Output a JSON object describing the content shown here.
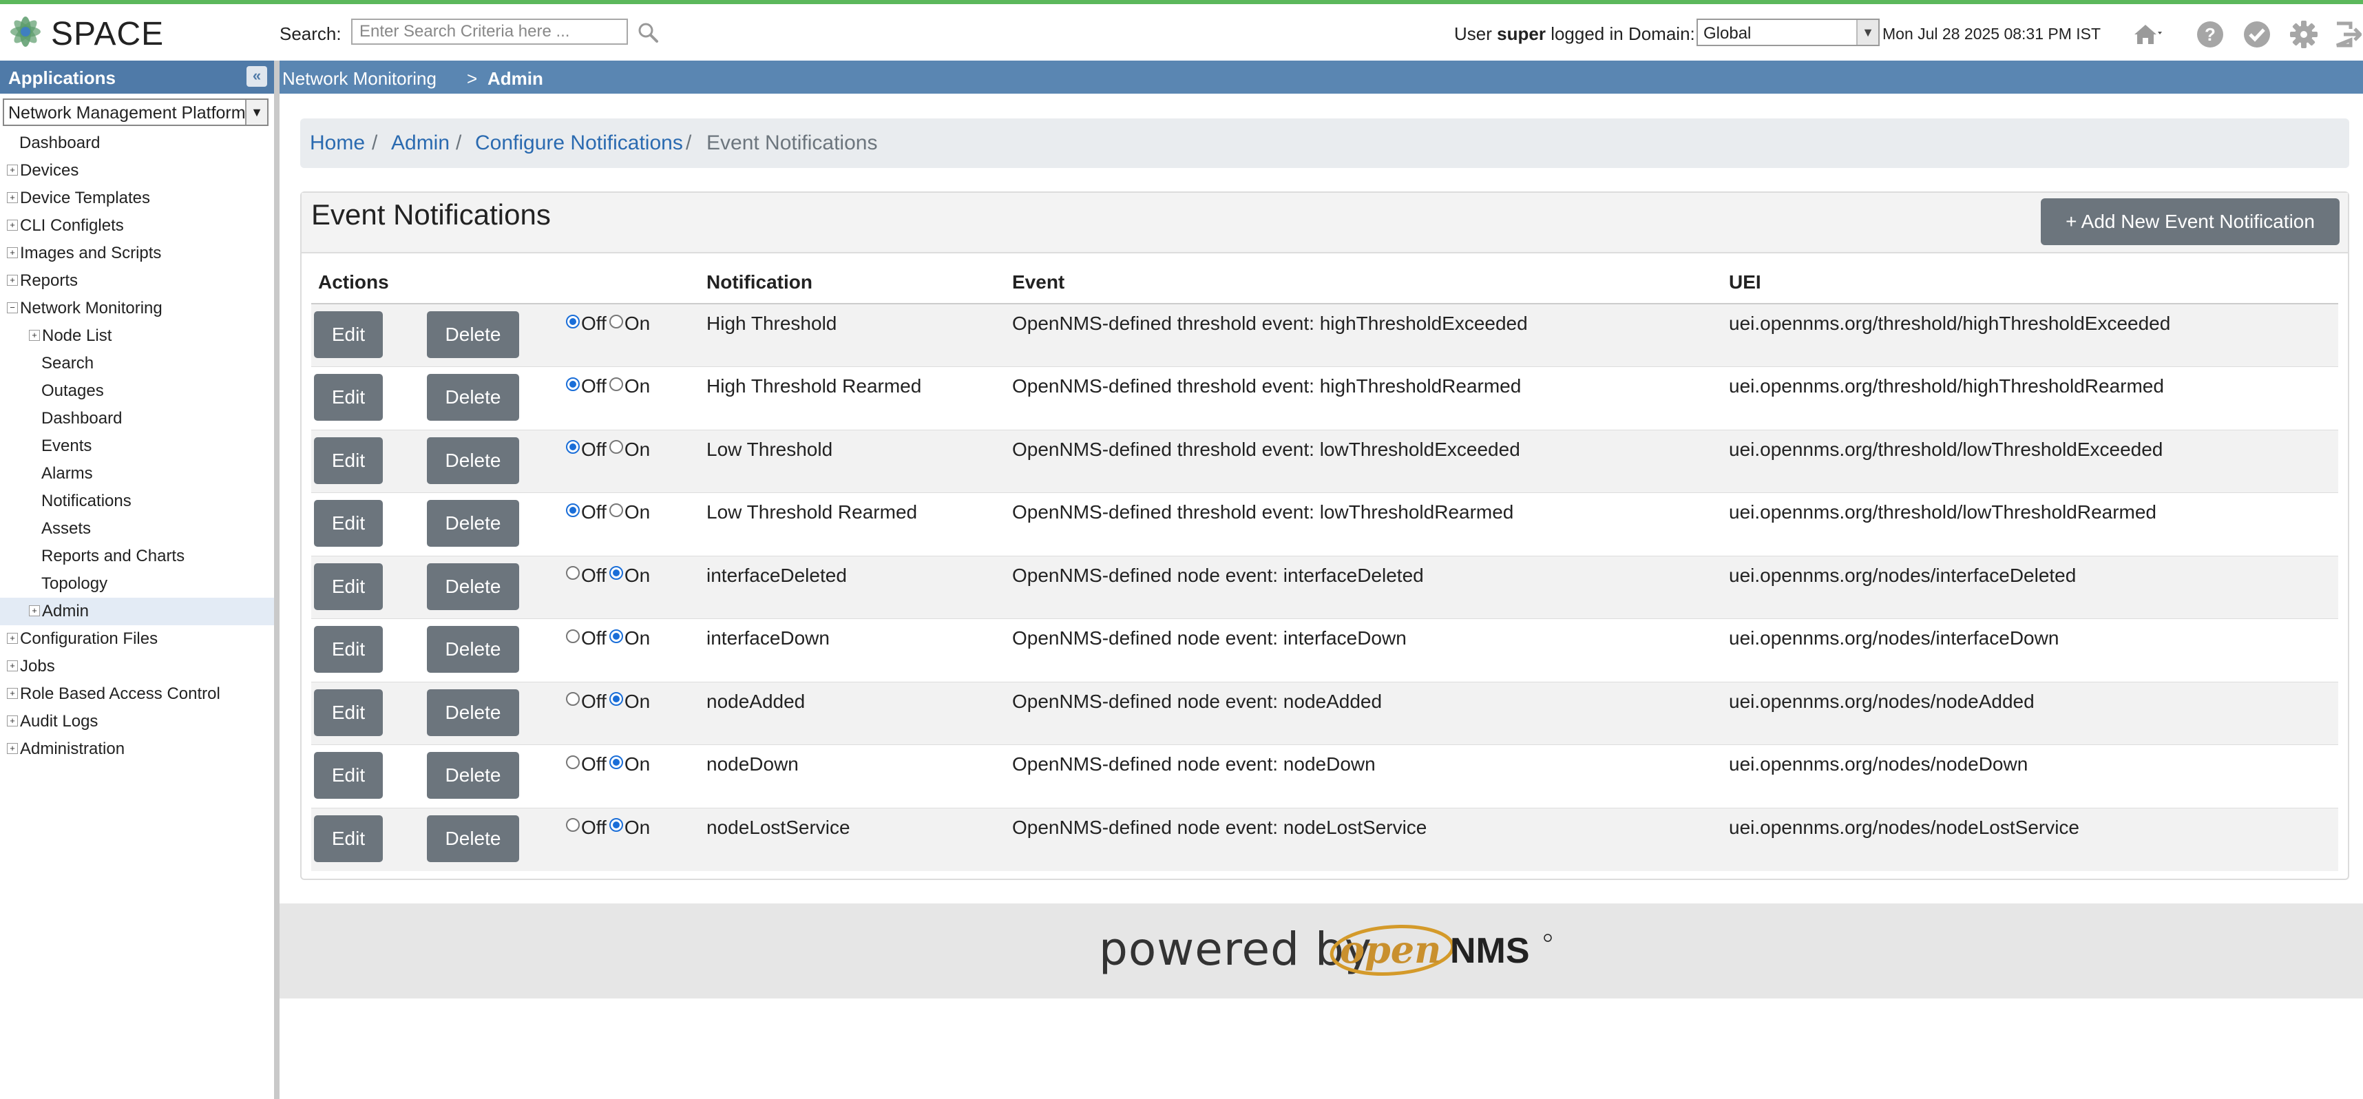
{
  "app": {
    "logo_text": "SPACE"
  },
  "search": {
    "label": "Search:",
    "placeholder": "Enter Search Criteria here ..."
  },
  "user": {
    "prefix": "User",
    "name": "super",
    "suffix": "logged in Domain:"
  },
  "domain": {
    "selected": "Global"
  },
  "datetime": "Mon Jul 28 2025 08:31 PM IST",
  "left_panel": {
    "header": "Applications",
    "platform_selected": "Network Management Platform",
    "tree": [
      {
        "label": "Dashboard",
        "level": 0,
        "expander": "none"
      },
      {
        "label": "Devices",
        "level": 0,
        "expander": "plus"
      },
      {
        "label": "Device Templates",
        "level": 0,
        "expander": "plus"
      },
      {
        "label": "CLI Configlets",
        "level": 0,
        "expander": "plus"
      },
      {
        "label": "Images and Scripts",
        "level": 0,
        "expander": "plus"
      },
      {
        "label": "Reports",
        "level": 0,
        "expander": "plus"
      },
      {
        "label": "Network Monitoring",
        "level": 0,
        "expander": "minus"
      },
      {
        "label": "Node List",
        "level": 1,
        "expander": "plus"
      },
      {
        "label": "Search",
        "level": 1,
        "expander": "none"
      },
      {
        "label": "Outages",
        "level": 1,
        "expander": "none"
      },
      {
        "label": "Dashboard",
        "level": 1,
        "expander": "none"
      },
      {
        "label": "Events",
        "level": 1,
        "expander": "none"
      },
      {
        "label": "Alarms",
        "level": 1,
        "expander": "none"
      },
      {
        "label": "Notifications",
        "level": 1,
        "expander": "none"
      },
      {
        "label": "Assets",
        "level": 1,
        "expander": "none"
      },
      {
        "label": "Reports and Charts",
        "level": 1,
        "expander": "none"
      },
      {
        "label": "Topology",
        "level": 1,
        "expander": "none"
      },
      {
        "label": "Admin",
        "level": 1,
        "expander": "plus",
        "selected": true
      },
      {
        "label": "Configuration Files",
        "level": 0,
        "expander": "plus"
      },
      {
        "label": "Jobs",
        "level": 0,
        "expander": "plus"
      },
      {
        "label": "Role Based Access Control",
        "level": 0,
        "expander": "plus"
      },
      {
        "label": "Audit Logs",
        "level": 0,
        "expander": "plus"
      },
      {
        "label": "Administration",
        "level": 0,
        "expander": "plus"
      }
    ]
  },
  "crumbbar": {
    "parent": "Network Monitoring",
    "sep": ">",
    "current": "Admin"
  },
  "breadcrumb": {
    "items": [
      "Home",
      "Admin",
      "Configure Notifications"
    ],
    "sep": "/",
    "active": "Event Notifications"
  },
  "card": {
    "title": "Event Notifications",
    "add_button": "+ Add New Event Notification"
  },
  "table": {
    "headers": {
      "actions": "Actions",
      "notification": "Notification",
      "event": "Event",
      "uei": "UEI"
    },
    "edit_label": "Edit",
    "delete_label": "Delete",
    "off_label": "Off",
    "on_label": "On",
    "rows": [
      {
        "notification": "High Threshold",
        "event": "OpenNMS-defined threshold event: highThresholdExceeded",
        "uei": "uei.opennms.org/threshold/highThresholdExceeded",
        "state": "off"
      },
      {
        "notification": "High Threshold Rearmed",
        "event": "OpenNMS-defined threshold event: highThresholdRearmed",
        "uei": "uei.opennms.org/threshold/highThresholdRearmed",
        "state": "off"
      },
      {
        "notification": "Low Threshold",
        "event": "OpenNMS-defined threshold event: lowThresholdExceeded",
        "uei": "uei.opennms.org/threshold/lowThresholdExceeded",
        "state": "off"
      },
      {
        "notification": "Low Threshold Rearmed",
        "event": "OpenNMS-defined threshold event: lowThresholdRearmed",
        "uei": "uei.opennms.org/threshold/lowThresholdRearmed",
        "state": "off"
      },
      {
        "notification": "interfaceDeleted",
        "event": "OpenNMS-defined node event: interfaceDeleted",
        "uei": "uei.opennms.org/nodes/interfaceDeleted",
        "state": "on"
      },
      {
        "notification": "interfaceDown",
        "event": "OpenNMS-defined node event: interfaceDown",
        "uei": "uei.opennms.org/nodes/interfaceDown",
        "state": "on"
      },
      {
        "notification": "nodeAdded",
        "event": "OpenNMS-defined node event: nodeAdded",
        "uei": "uei.opennms.org/nodes/nodeAdded",
        "state": "on"
      },
      {
        "notification": "nodeDown",
        "event": "OpenNMS-defined node event: nodeDown",
        "uei": "uei.opennms.org/nodes/nodeDown",
        "state": "on"
      },
      {
        "notification": "nodeLostService",
        "event": "OpenNMS-defined node event: nodeLostService",
        "uei": "uei.opennms.org/nodes/nodeLostService",
        "state": "on"
      }
    ]
  },
  "footer": {
    "powered_by": "powered by",
    "brand_open": "open",
    "brand_nms": "NMS"
  },
  "icons": {
    "home": "home-icon",
    "help": "help-icon",
    "check": "check-icon",
    "settings": "gear-icon",
    "logout": "logout-icon"
  },
  "colors": {
    "accent": "#5a86b2",
    "header_blue": "#4f7aa8",
    "button_gray": "#6c757d",
    "link": "#2a6ab0",
    "top_line": "#5cb85c"
  }
}
